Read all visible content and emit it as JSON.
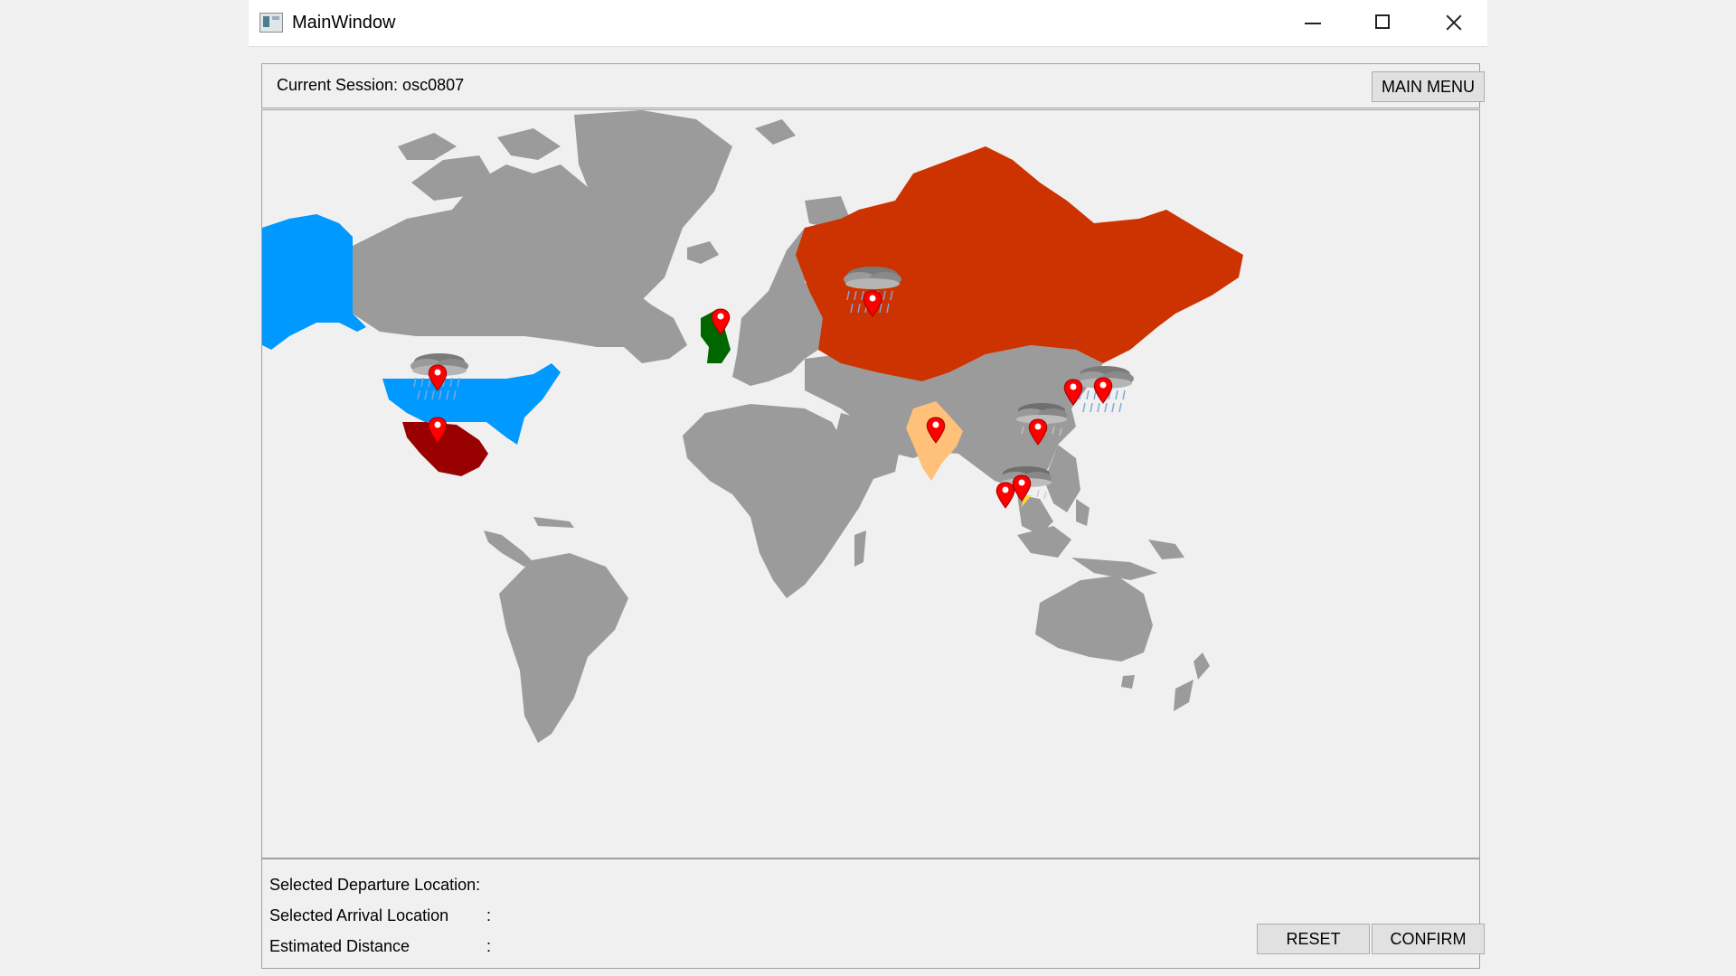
{
  "window": {
    "title": "MainWindow",
    "controls": [
      "minimize-icon",
      "maximize-icon",
      "close-icon"
    ]
  },
  "session": {
    "label": "Current Session: osc0807",
    "main_menu_label": "MAIN MENU"
  },
  "map": {
    "colors": {
      "land": "#9b9b9b",
      "usa": "#0099ff",
      "alaska": "#0099ff",
      "mexico": "#990000",
      "russia": "#cc3300",
      "uk": "#006600",
      "india": "#ffc07a",
      "pin": "#ff0000",
      "background": "#f0f0f0"
    },
    "highlighted_countries": [
      "USA",
      "Alaska",
      "Mexico",
      "UK",
      "Russia",
      "India"
    ],
    "pins": [
      "usa-pin",
      "mexico-pin",
      "uk-pin",
      "russia-pin",
      "india-pin",
      "china-pin",
      "korea-pin",
      "japan-pin",
      "sea-pin-1",
      "sea-pin-2"
    ],
    "weather_icons": [
      "rain-cloud-icon",
      "rain-cloud-icon",
      "storm-cloud-icon",
      "storm-cloud-icon",
      "storm-cloud-icon"
    ]
  },
  "info": {
    "departure_label": "Selected Departure Location:",
    "departure_value": "",
    "arrival_label": "Selected Arrival Location",
    "arrival_colon": ":",
    "arrival_value": "",
    "distance_label": "Estimated Distance",
    "distance_colon": ":",
    "distance_value": ""
  },
  "buttons": {
    "reset": "RESET",
    "confirm": "CONFIRM"
  }
}
